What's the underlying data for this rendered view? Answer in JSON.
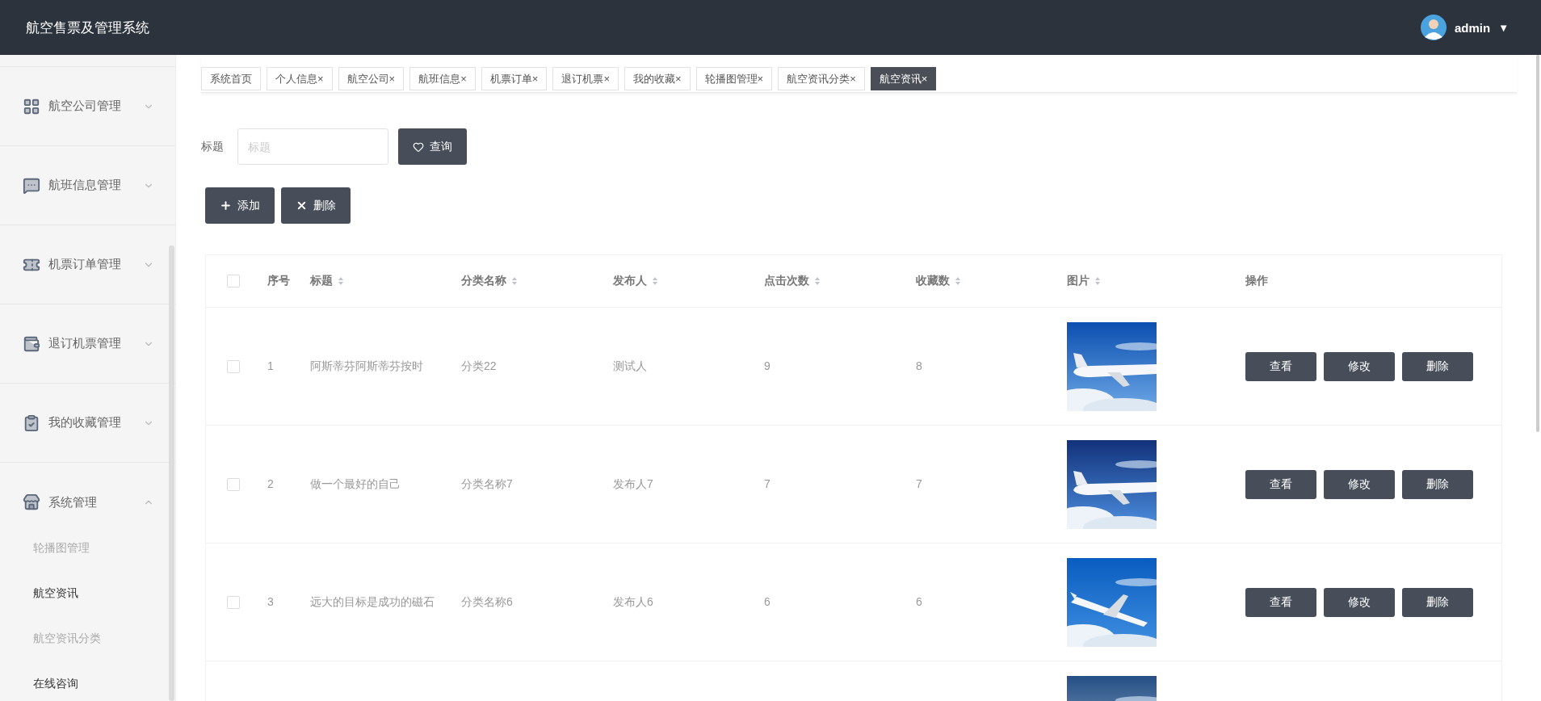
{
  "header": {
    "title": "航空售票及管理系统",
    "user": "admin",
    "caret": "▼"
  },
  "sidebar": {
    "items": [
      {
        "label": "航空公司管理",
        "expanded": false
      },
      {
        "label": "航班信息管理",
        "expanded": false
      },
      {
        "label": "机票订单管理",
        "expanded": false
      },
      {
        "label": "退订机票管理",
        "expanded": false
      },
      {
        "label": "我的收藏管理",
        "expanded": false
      },
      {
        "label": "系统管理",
        "expanded": true,
        "children": [
          {
            "label": "轮播图管理",
            "selected": false,
            "hovered": false
          },
          {
            "label": "航空资讯",
            "selected": true,
            "hovered": false
          },
          {
            "label": "航空资讯分类",
            "selected": false,
            "hovered": false
          },
          {
            "label": "在线咨询",
            "selected": false,
            "hovered": true
          }
        ]
      }
    ]
  },
  "tabs": [
    {
      "label": "系统首页",
      "selected": false
    },
    {
      "label": "个人信息",
      "close": "×",
      "selected": false
    },
    {
      "label": "航空公司",
      "close": "×",
      "selected": false
    },
    {
      "label": "航班信息",
      "close": "×",
      "selected": false
    },
    {
      "label": "机票订单",
      "close": "×",
      "selected": false
    },
    {
      "label": "退订机票",
      "close": "×",
      "selected": false
    },
    {
      "label": "我的收藏",
      "close": "×",
      "selected": false
    },
    {
      "label": "轮播图管理",
      "close": "×",
      "selected": false
    },
    {
      "label": "航空资讯分类",
      "close": "×",
      "selected": false
    },
    {
      "label": "航空资讯",
      "close": "×",
      "selected": true
    }
  ],
  "search": {
    "label": "标题",
    "placeholder": "标题",
    "button": "查询"
  },
  "actions": [
    {
      "label": "添加",
      "kind": "add"
    },
    {
      "label": "删除",
      "kind": "delete"
    }
  ],
  "table": {
    "all_checked": false,
    "columns": [
      {
        "label": "序号",
        "sortable": false
      },
      {
        "label": "标题",
        "sortable": true
      },
      {
        "label": "分类名称",
        "sortable": true
      },
      {
        "label": "发布人",
        "sortable": true
      },
      {
        "label": "点击次数",
        "sortable": true
      },
      {
        "label": "收藏数",
        "sortable": true
      },
      {
        "label": "图片",
        "sortable": true
      },
      {
        "label": "操作",
        "sortable": false
      }
    ],
    "rows": [
      {
        "checked": false,
        "cells": [
          "1",
          "阿斯蒂芬阿斯蒂芬按时",
          "分类22",
          "测试人",
          "9",
          "8"
        ],
        "image": {
          "kind": "picture"
        },
        "actions": [
          "查看",
          "修改",
          "删除"
        ]
      },
      {
        "checked": false,
        "cells": [
          "2",
          "做一个最好的自己",
          "分类名称7",
          "发布人7",
          "7",
          "7"
        ],
        "image": {
          "kind": "picture"
        },
        "actions": [
          "查看",
          "修改",
          "删除"
        ]
      },
      {
        "checked": false,
        "cells": [
          "3",
          "远大的目标是成功的磁石",
          "分类名称6",
          "发布人6",
          "6",
          "6"
        ],
        "image": {
          "kind": "picture"
        },
        "actions": [
          "查看",
          "修改",
          "删除"
        ]
      },
      {
        "image": {
          "kind": "picture"
        }
      }
    ]
  }
}
